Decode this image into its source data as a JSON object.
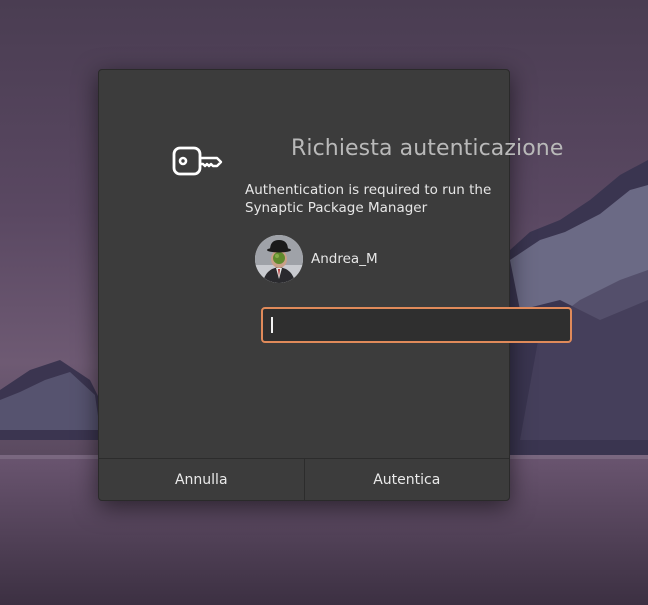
{
  "dialog": {
    "title": "Richiesta autenticazione",
    "message": "Authentication is required to run the Synaptic Package Manager",
    "icon": "key-icon",
    "user": {
      "name": "Andrea_M",
      "avatar": "avatar-icon"
    },
    "password": {
      "value": ""
    },
    "buttons": {
      "cancel_label": "Annulla",
      "authenticate_label": "Autentica"
    }
  },
  "colors": {
    "dialog_bg": "#3c3c3c",
    "input_focus_border": "#e08a5a",
    "title_text": "#b9b9b9"
  }
}
